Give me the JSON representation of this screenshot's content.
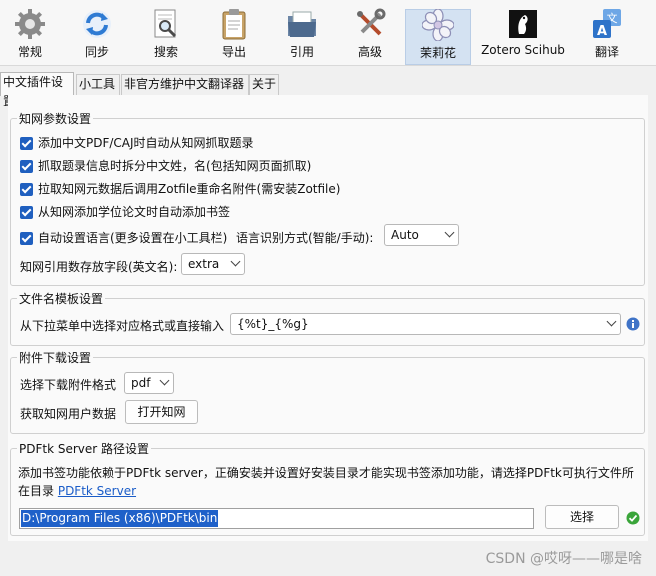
{
  "toolbar": {
    "items": [
      {
        "label": "常规",
        "icon": "gear-icon"
      },
      {
        "label": "同步",
        "icon": "sync-icon"
      },
      {
        "label": "搜索",
        "icon": "search-icon"
      },
      {
        "label": "导出",
        "icon": "clipboard-icon"
      },
      {
        "label": "引用",
        "icon": "folder-icon"
      },
      {
        "label": "高级",
        "icon": "tools-icon"
      },
      {
        "label": "茉莉花",
        "icon": "jasmine-icon"
      },
      {
        "label": "Zotero Scihub",
        "icon": "scihub-icon"
      },
      {
        "label": "翻译",
        "icon": "translate-icon"
      }
    ],
    "active_index": 6
  },
  "tabs": [
    "中文插件设置",
    "小工具",
    "非官方维护中文翻译器",
    "关于"
  ],
  "cnki": {
    "title": "知网参数设置",
    "options": [
      "添加中文PDF/CAJ时自动从知网抓取题录",
      "抓取题录信息时拆分中文姓，名(包括知网页面抓取)",
      "拉取知网元数据后调用Zotfile重命名附件(需安装Zotfile)",
      "从知网添加学位论文时自动添加书签",
      "自动设置语言(更多设置在小工具栏)"
    ],
    "lang_detect_label": "语言识别方式(智能/手动):",
    "lang_detect_value": "Auto",
    "citation_field_label": "知网引用数存放字段(英文名):",
    "citation_field_value": "extra"
  },
  "filename": {
    "title": "文件名模板设置",
    "label": "从下拉菜单中选择对应格式或直接输入",
    "value": "{%t}_{%g}",
    "info_icon": "info-icon"
  },
  "attachment": {
    "title": "附件下载设置",
    "format_label": "选择下载附件格式",
    "format_value": "pdf",
    "user_data_label": "获取知网用户数据",
    "open_button": "打开知网"
  },
  "pdftk": {
    "title": "PDFtk Server 路径设置",
    "desc_line1": "添加书签功能依赖于PDFtk server，正确安装并设置好安装目录才能实现书签添加功能，请选择PDFtk可执行文件所",
    "desc_line2_prefix": "在目录 ",
    "link": "PDFtk Server",
    "path_value": "D:\\Program Files (x86)\\PDFtk\\bin",
    "choose_button": "选择",
    "status_icon": "check-icon",
    "status_color": "#3aa53a"
  },
  "watermark": "CSDN @哎呀——哪是啥"
}
